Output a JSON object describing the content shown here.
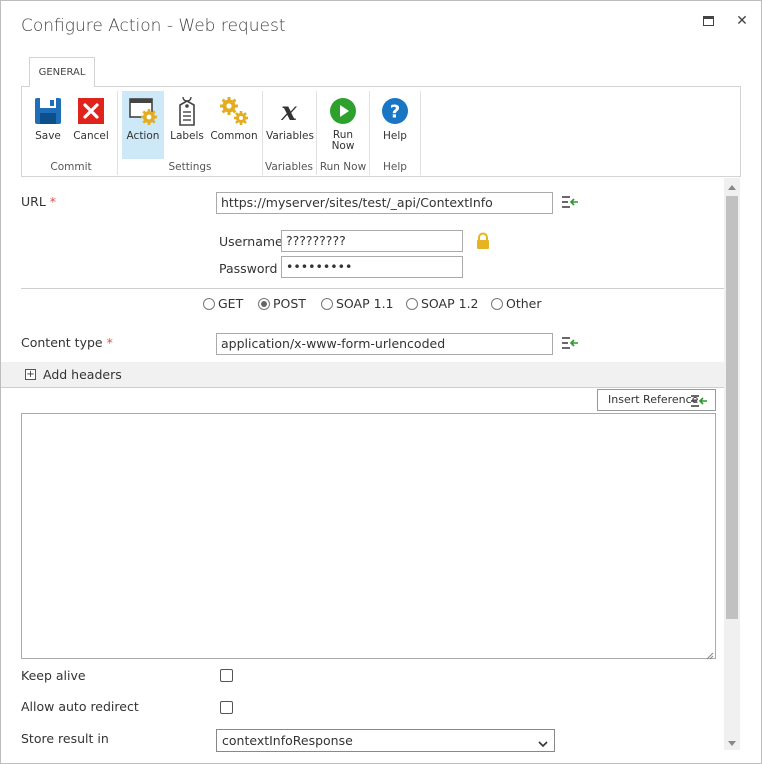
{
  "window": {
    "title": "Configure Action - Web request",
    "maximize_glyph": "maximize-icon",
    "close_glyph": "✕"
  },
  "ribbon": {
    "tab": "GENERAL",
    "buttons": {
      "save": "Save",
      "cancel": "Cancel",
      "action": "Action",
      "labels": "Labels",
      "common": "Common",
      "variables": "Variables",
      "run_now_line1": "Run",
      "run_now_line2": "Now",
      "help": "Help"
    },
    "groups": {
      "commit": "Commit",
      "settings": "Settings",
      "variables": "Variables",
      "run_now": "Run Now",
      "help": "Help"
    }
  },
  "form": {
    "url_label": "URL",
    "required_mark": "*",
    "url_value": "https://myserver/sites/test/_api/ContextInfo",
    "username_label": "Username",
    "username_value": "?????????",
    "password_label": "Password",
    "password_value": "•••••••••",
    "methods": [
      "GET",
      "POST",
      "SOAP 1.1",
      "SOAP 1.2",
      "Other"
    ],
    "selected_method": "POST",
    "content_type_label": "Content type",
    "content_type_value": "application/x-www-form-urlencoded",
    "add_headers_label": "Add headers",
    "add_headers_toggle": "+",
    "insert_reference_label": "Insert Reference",
    "keep_alive_label": "Keep alive",
    "keep_alive_checked": false,
    "allow_redirect_label": "Allow auto redirect",
    "allow_redirect_checked": false,
    "store_result_label": "Store result in",
    "store_result_value": "contextInfoResponse"
  },
  "colors": {
    "save_blue": "#1e6fb8",
    "cancel_red": "#e0231c",
    "gear_gold": "#e2ad22",
    "run_green": "#2ea12c",
    "help_blue": "#1976c5",
    "lock_gold": "#e6b422",
    "insert_green": "#2a9a2a"
  }
}
